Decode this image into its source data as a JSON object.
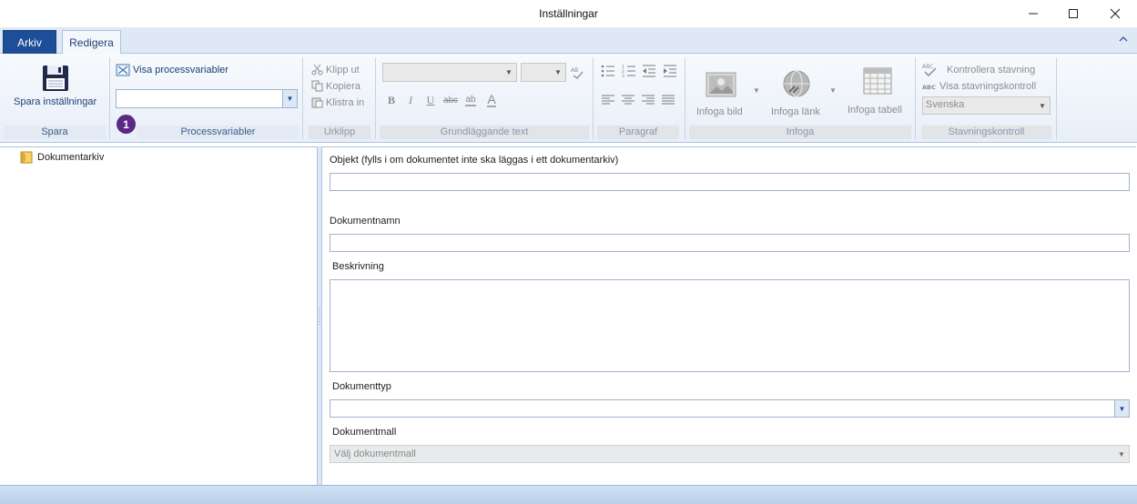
{
  "window": {
    "title": "Inställningar"
  },
  "tabs": {
    "arkiv": "Arkiv",
    "redigera": "Redigera"
  },
  "ribbon": {
    "spara": {
      "save_label": "Spara inställningar",
      "group_label": "Spara"
    },
    "processvariabler": {
      "show_label": "Visa processvariabler",
      "combo_value": "",
      "group_label": "Processvariabler",
      "badge": "1"
    },
    "urklipp": {
      "cut": "Klipp ut",
      "copy": "Kopiera",
      "paste": "Klistra in",
      "group_label": "Urklipp"
    },
    "grundlaggande": {
      "group_label": "Grundläggande text"
    },
    "paragraf": {
      "group_label": "Paragraf"
    },
    "infoga": {
      "image": "Infoga bild",
      "link": "Infoga länk",
      "table": "Infoga tabell",
      "group_label": "Infoga"
    },
    "stavning": {
      "check": "Kontrollera stavning",
      "show": "Visa stavningskontroll",
      "language": "Svenska",
      "group_label": "Stavningskontroll"
    }
  },
  "tree": {
    "root": "Dokumentarkiv"
  },
  "form": {
    "objekt_label": "Objekt (fylls i om dokumentet inte ska läggas i ett dokumentarkiv)",
    "objekt_value": "",
    "dokumentnamn_label": "Dokumentnamn",
    "dokumentnamn_value": "",
    "beskrivning_label": "Beskrivning",
    "beskrivning_value": "",
    "dokumenttyp_label": "Dokumenttyp",
    "dokumenttyp_value": "",
    "dokumentmall_label": "Dokumentmall",
    "dokumentmall_placeholder": "Välj dokumentmall"
  },
  "colors": {
    "accent": "#1f4e99",
    "badge": "#5b2a86",
    "ribbon_border": "#a9c3e1"
  }
}
